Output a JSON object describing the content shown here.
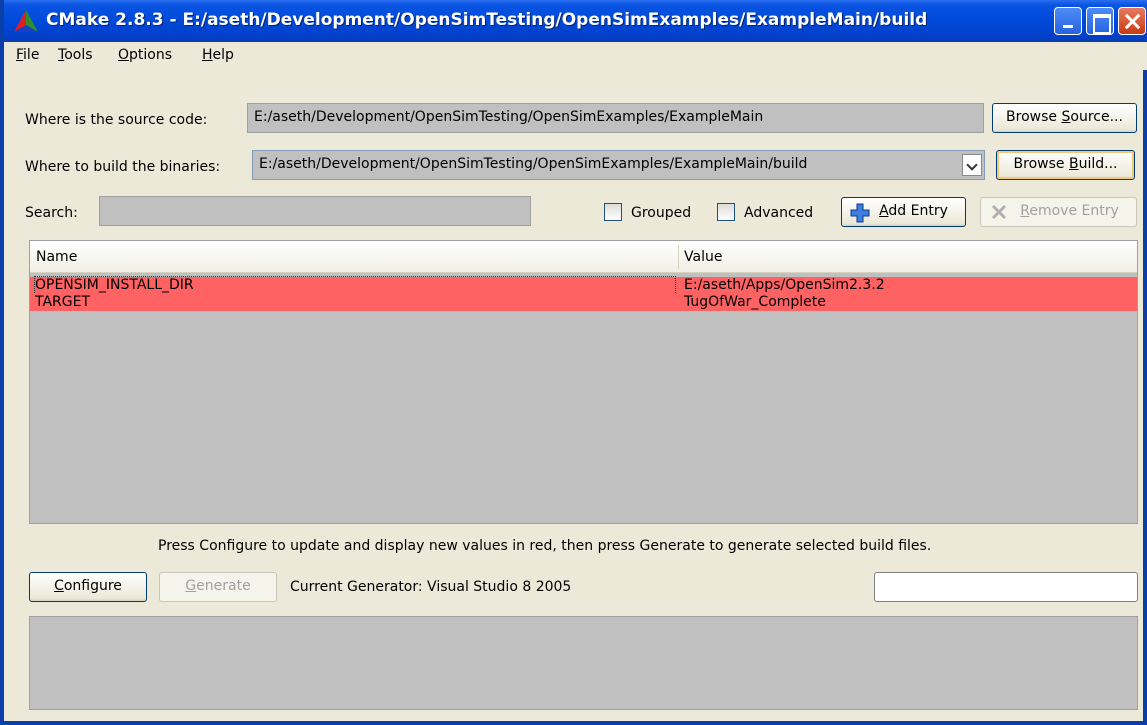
{
  "window": {
    "title": "CMake 2.8.3 - E:/aseth/Development/OpenSimTesting/OpenSimExamples/ExampleMain/build",
    "accent": "#0054e3",
    "controls": {
      "minimize": "minimize-icon",
      "maximize": "maximize-icon",
      "close": "close-icon"
    }
  },
  "menu": {
    "file": {
      "mnemonic": "F",
      "rest": "ile"
    },
    "tools": {
      "mnemonic": "T",
      "rest": "ools"
    },
    "options": {
      "mnemonic": "O",
      "rest": "ptions"
    },
    "help": {
      "mnemonic": "H",
      "rest": "elp"
    }
  },
  "source": {
    "label": "Where is the source code:",
    "value": "E:/aseth/Development/OpenSimTesting/OpenSimExamples/ExampleMain",
    "browse": {
      "pre": "Browse ",
      "mnemonic": "S",
      "post": "ource..."
    }
  },
  "build": {
    "label": "Where to build the binaries:",
    "value": "E:/aseth/Development/OpenSimTesting/OpenSimExamples/ExampleMain/build",
    "browse": {
      "pre": "Browse ",
      "mnemonic": "B",
      "post": "uild..."
    }
  },
  "search": {
    "label": "Search:",
    "value": ""
  },
  "options": {
    "grouped": {
      "label": "Grouped",
      "checked": false
    },
    "advanced": {
      "label": "Advanced",
      "checked": false
    }
  },
  "entry_buttons": {
    "add": {
      "mnemonic": "A",
      "rest": "dd Entry",
      "icon": "plus-icon"
    },
    "remove": {
      "mnemonic": "R",
      "rest": "emove Entry",
      "icon": "remove-x-icon",
      "disabled": true
    }
  },
  "table": {
    "columns": [
      "Name",
      "Value"
    ],
    "row_color": "#ff6262",
    "rows": [
      {
        "name": "OPENSIM_INSTALL_DIR",
        "value": "E:/aseth/Apps/OpenSim2.3.2"
      },
      {
        "name": "TARGET",
        "value": "TugOfWar_Complete"
      }
    ]
  },
  "hint": "Press Configure to update and display new values in red, then press Generate to generate selected build files.",
  "actions": {
    "configure": {
      "mnemonic": "C",
      "rest": "onfigure"
    },
    "generate": {
      "mnemonic": "G",
      "rest": "enerate",
      "disabled": true
    }
  },
  "generator": "Current Generator: Visual Studio 8 2005"
}
